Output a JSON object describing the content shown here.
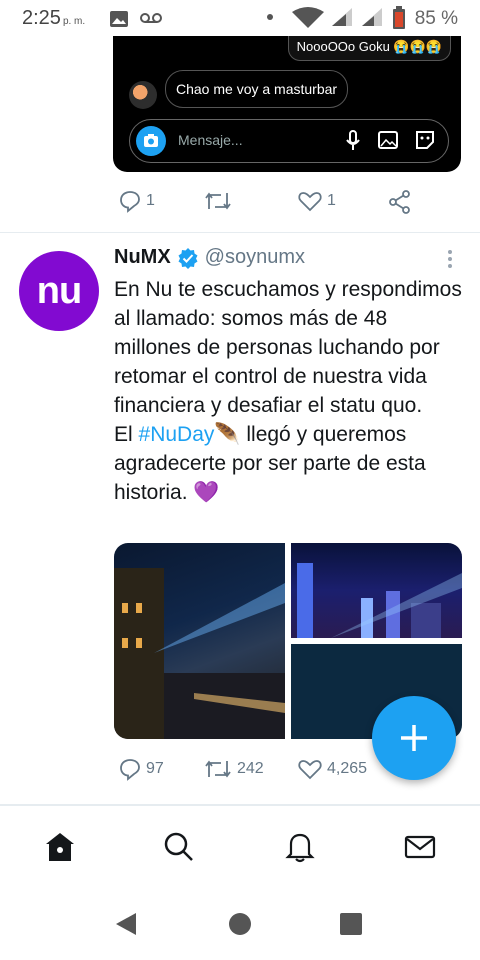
{
  "status_bar": {
    "time": "2:25",
    "ampm": "p. m.",
    "battery_percent": "85 %",
    "icons": [
      "image-icon",
      "voicemail-icon",
      "dot-icon",
      "wifi-icon",
      "signal-icon",
      "signal-icon",
      "battery-icon"
    ]
  },
  "prev_tweet": {
    "dm_preview": {
      "reply_text": "NoooOOo Goku 😭😭😭",
      "message_text": "Chao me voy a masturbar",
      "input_placeholder": "Mensaje..."
    },
    "actions": {
      "replies": "1",
      "retweets": "",
      "likes": "1"
    }
  },
  "tweet": {
    "name": "NuMX",
    "verified": true,
    "handle": "@soynumx",
    "avatar_text": "nu",
    "text_lines": [
      "En Nu te escuchamos y respondimos al llamado: somos más de 48 millones de personas luchando por retomar el control de nuestra vida financiera y desafiar el statu quo."
    ],
    "text2_before": "El ",
    "hashtag": "#NuDay",
    "text2_after": "🪶 llegó y queremos agradecerte por ser parte de esta historia. 💜",
    "actions": {
      "replies": "97",
      "retweets": "242",
      "likes": "4,265"
    }
  },
  "colors": {
    "accent": "#1da1f2",
    "nu_purple": "#820ad1"
  },
  "bottom_nav": [
    "home-icon",
    "search-icon",
    "notifications-icon",
    "messages-icon"
  ],
  "system_nav": [
    "back-icon",
    "home-circle-icon",
    "recents-icon"
  ]
}
